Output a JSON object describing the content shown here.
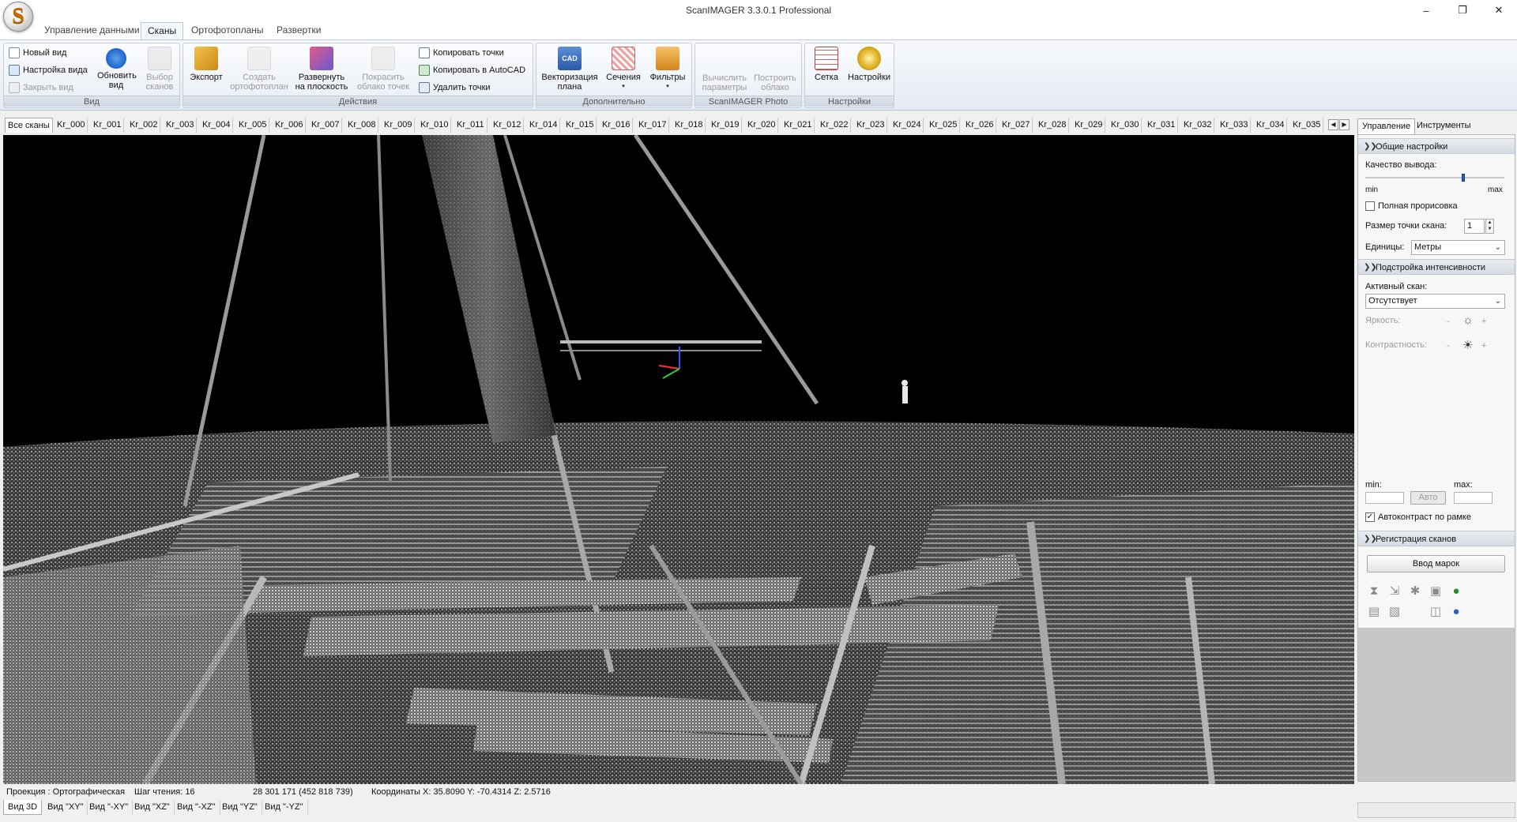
{
  "window": {
    "title": "ScanIMAGER 3.3.0.1 Professional",
    "logo_letter": "S",
    "controls": {
      "minimize": "–",
      "restore": "❐",
      "close": "✕"
    }
  },
  "ribbon_tabs": [
    "Управление данными",
    "Сканы",
    "Ортофотопланы",
    "Развертки"
  ],
  "ribbon": {
    "view_group": {
      "label": "Вид",
      "new_view": "Новый вид",
      "view_settings": "Настройка вида",
      "close_view": "Закрыть вид",
      "refresh_view": "Обновить вид",
      "select_scans": "Выбор сканов"
    },
    "actions_group": {
      "label": "Действия",
      "export": "Экспорт",
      "create_orthophoto": "Создать ортофотоплан",
      "unfold_plane": "Развернуть на плоскость",
      "color_cloud": "Покрасить облако точек",
      "copy_points": "Копировать точки",
      "copy_autocad": "Копировать в AutoCAD",
      "delete_points": "Удалить точки"
    },
    "extra_group": {
      "label": "Дополнительно",
      "vectorize": "Векторизация плана",
      "sections": "Сечения",
      "filters": "Фильтры"
    },
    "photo_group": {
      "label": "ScanIMAGER Photo",
      "compute_params": "Вычислить параметры",
      "build_cloud": "Построить облако"
    },
    "settings_group": {
      "label": "Настройки",
      "grid": "Сетка",
      "settings": "Настройки"
    }
  },
  "scan_tabs": [
    "Все сканы",
    "Kr_000",
    "Kr_001",
    "Kr_002",
    "Kr_003",
    "Kr_004",
    "Kr_005",
    "Kr_006",
    "Kr_007",
    "Kr_008",
    "Kr_009",
    "Kr_010",
    "Kr_011",
    "Kr_012",
    "Kr_014",
    "Kr_015",
    "Kr_016",
    "Kr_017",
    "Kr_018",
    "Kr_019",
    "Kr_020",
    "Kr_021",
    "Kr_022",
    "Kr_023",
    "Kr_024",
    "Kr_025",
    "Kr_026",
    "Kr_027",
    "Kr_028",
    "Kr_029",
    "Kr_030",
    "Kr_031",
    "Kr_032",
    "Kr_033",
    "Kr_034",
    "Kr_035"
  ],
  "status": {
    "projection": "Проекция : Ортографическая",
    "read_step": "Шаг чтения: 16",
    "points": "28 301 171 (452 818 739)",
    "coords": "Координаты X: 35.8090  Y: -70.4314  Z: 2.5716"
  },
  "view_tabs": [
    "Вид 3D",
    "Вид \"XY\"",
    "Вид \"-XY\"",
    "Вид \"XZ\"",
    "Вид \"-XZ\"",
    "Вид \"YZ\"",
    "Вид \"-YZ\""
  ],
  "panel": {
    "tabs": [
      "Управление",
      "Инструменты"
    ],
    "general": {
      "header": "Общие настройки",
      "quality_label": "Качество вывода:",
      "quality_level": 0.71,
      "min": "min",
      "max": "max",
      "full_render": "Полная прорисовка",
      "point_size_label": "Размер точки скана:",
      "point_size": "1",
      "units_label": "Единицы:",
      "units_value": "Метры"
    },
    "intensity": {
      "header": "Подстройка интенсивности",
      "active_scan_label": "Активный скан:",
      "active_scan_value": "Отсутствует",
      "brightness": "Яркость:",
      "contrast": "Контрастность:",
      "minus": "-",
      "plus": "+",
      "min_label": "min:",
      "max_label": "max:",
      "auto_button": "Авто",
      "autocontrast": "Автоконтраст по рамке"
    },
    "registration": {
      "header": "Регистрация сканов",
      "enter_marks": "Ввод марок"
    }
  },
  "colors": {
    "viewport_bg": "#000000",
    "ribbon_bg": "#e6ebf2",
    "accent_blue": "#1e64c8"
  }
}
